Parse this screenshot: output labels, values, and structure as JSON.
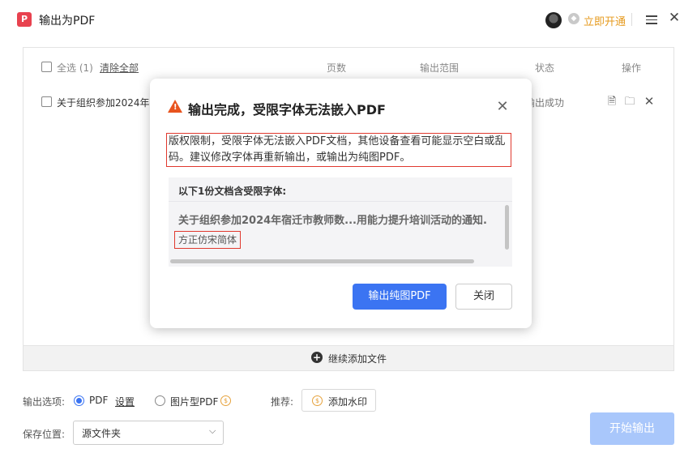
{
  "window": {
    "title": "输出为PDF",
    "app_icon": "pdf-app-icon",
    "vip_link": "立即开通",
    "close": "✕"
  },
  "file_list": {
    "header": {
      "select_all": "全选 (1)",
      "clear_all": "清除全部",
      "pages": "页数",
      "range": "输出范围",
      "status": "状态",
      "actions": "操作"
    },
    "rows": [
      {
        "name": "关于组织参加2024年宿",
        "status": "输出成功"
      }
    ],
    "add_more": "继续添加文件"
  },
  "options": {
    "output_label": "输出选项:",
    "pdf": "PDF",
    "settings": "设置",
    "image_pdf": "图片型PDF",
    "recommend_label": "推荐:",
    "watermark": "添加水印",
    "save_label": "保存位置:",
    "save_value": "源文件夹",
    "start": "开始输出"
  },
  "dialog": {
    "title": "输出完成，受限字体无法嵌入PDF",
    "description": "版权限制，受限字体无法嵌入PDF文档，其他设备查看可能显示空白或乱码。建议修改字体再重新输出，或输出为纯图PDF。",
    "list_header": "以下1份文档含受限字体:",
    "document": "关于组织参加2024年宿迁市教师数...用能力提升培训活动的通知.",
    "font": "方正仿宋简体",
    "primary_button": "输出纯图PDF",
    "close_button": "关闭"
  },
  "colors": {
    "accent": "#3b74f2",
    "warning": "#e8541e",
    "highlight_border": "#e0392e",
    "vip": "#e69a1e"
  }
}
